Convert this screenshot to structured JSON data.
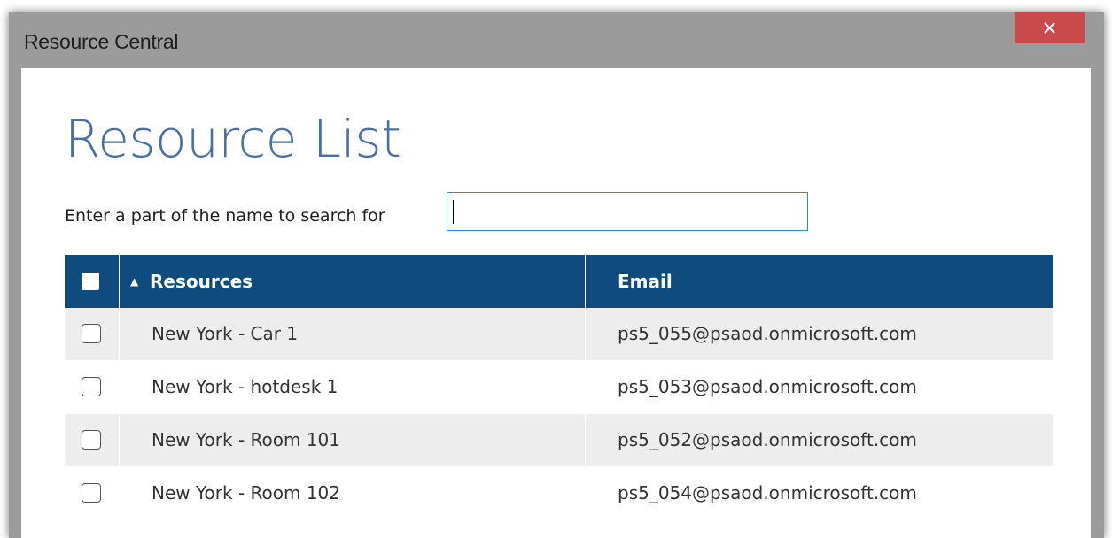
{
  "window": {
    "title": "Resource Central",
    "close_label": "×"
  },
  "main": {
    "heading": "Resource List",
    "search": {
      "label": "Enter a part of the name to search for",
      "value": "",
      "placeholder": ""
    }
  },
  "table": {
    "columns": [
      "Resources",
      "Email"
    ],
    "sort": {
      "column": "Resources",
      "direction": "ascending",
      "indicator": "▲"
    },
    "rows": [
      {
        "resource": "New York - Car 1",
        "email": "ps5_055@psaod.onmicrosoft.com",
        "checked": false
      },
      {
        "resource": "New York - hotdesk 1",
        "email": "ps5_053@psaod.onmicrosoft.com",
        "checked": false
      },
      {
        "resource": "New York - Room 101",
        "email": "ps5_052@psaod.onmicrosoft.com",
        "checked": false
      },
      {
        "resource": "New York - Room 102",
        "email": "ps5_054@psaod.onmicrosoft.com",
        "checked": false
      }
    ]
  },
  "colors": {
    "accent_title": "#4a6fa8",
    "header_bg": "#0f4c7d",
    "close_bg": "#c94a4a",
    "row_alt_bg": "#ededed",
    "input_border": "#2a8bd0"
  },
  "icons": {
    "close": "close-icon",
    "sort": "sort-ascending-icon"
  }
}
